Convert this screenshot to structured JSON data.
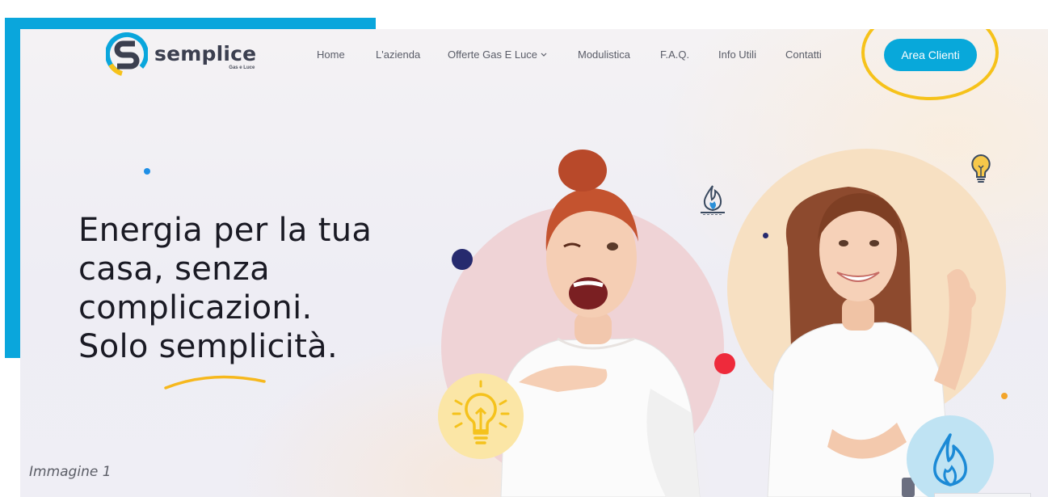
{
  "header": {
    "logo": {
      "name": "semplice",
      "tagline": "Gas e Luce"
    },
    "nav": [
      {
        "label": "Home",
        "has_dropdown": false
      },
      {
        "label": "L'azienda",
        "has_dropdown": false
      },
      {
        "label": "Offerte Gas E Luce",
        "has_dropdown": true
      },
      {
        "label": "Modulistica",
        "has_dropdown": false
      },
      {
        "label": "F.A.Q.",
        "has_dropdown": false
      },
      {
        "label": "Info Utili",
        "has_dropdown": false
      },
      {
        "label": "Contatti",
        "has_dropdown": false
      }
    ],
    "cta_label": "Area Clienti"
  },
  "hero": {
    "title_lines": [
      "Energia per la tua",
      "casa, senza",
      "complicazioni.",
      "Solo semplicità."
    ]
  },
  "caption": "Immagine 1",
  "icons": {
    "logo": "semplice-s-logo-icon",
    "dropdown": "chevron-down-icon",
    "bulb": "light-bulb-icon",
    "flame": "gas-flame-icon"
  },
  "colors": {
    "accent_blue": "#0aa6dc",
    "cta": "#08a8da",
    "highlight_ring": "#f6c21a",
    "navy_dot": "#262a6e",
    "red_dot": "#ee2a3b",
    "orange_dot": "#f3a52a",
    "underline": "#f6b81d"
  }
}
